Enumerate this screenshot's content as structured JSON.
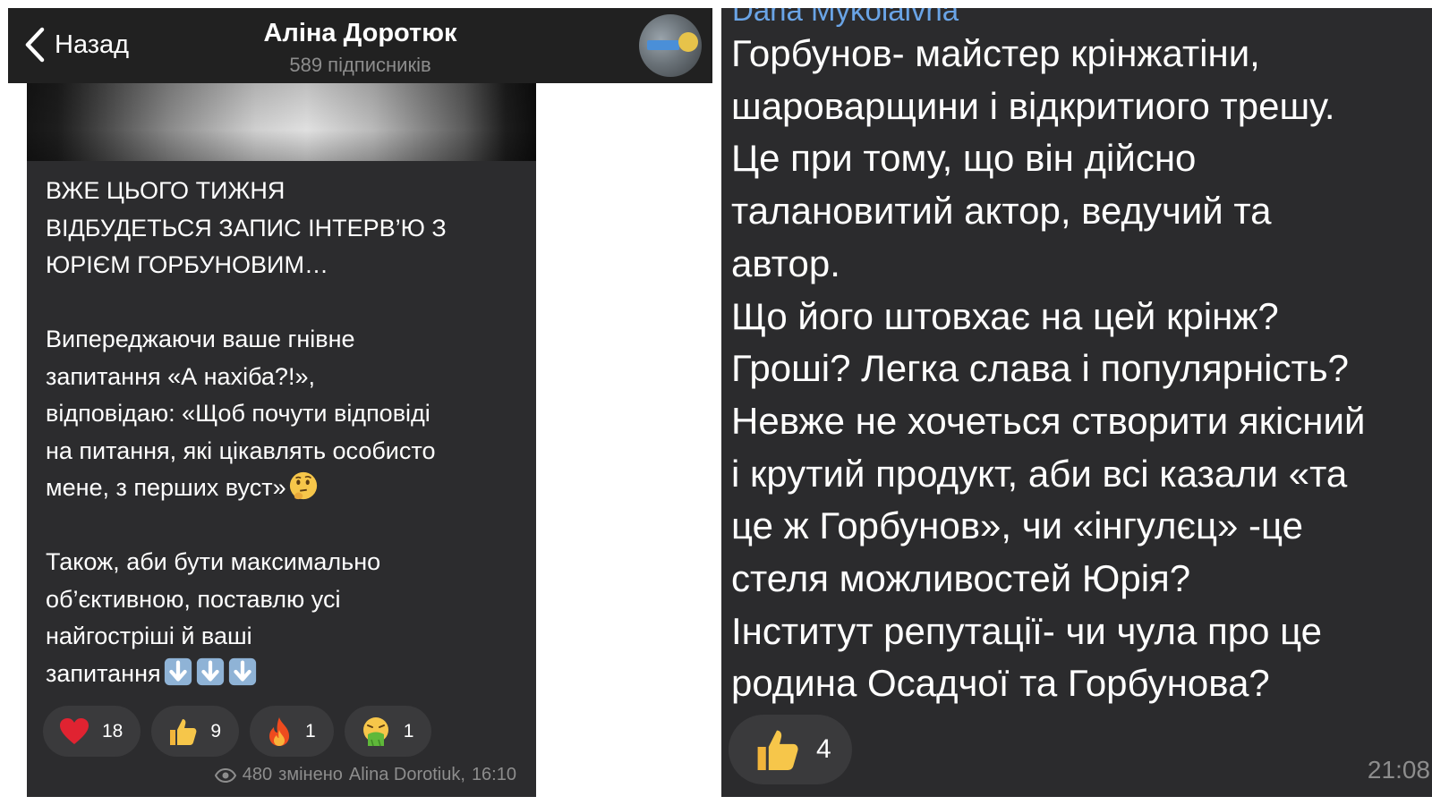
{
  "header": {
    "back_label": "Назад",
    "title": "Аліна Доротюк",
    "subtitle": "589 підписників"
  },
  "post": {
    "paragraphs": [
      [
        "ВЖЕ ЦЬОГО ТИЖНЯ",
        "ВІДБУДЕТЬСЯ ЗАПИС ІНТЕРВ’Ю З",
        "ЮРІЄМ ГОРБУНОВИМ…"
      ],
      [
        "Випереджаючи ваше гнівне",
        "запитання «А нахіба?!»,",
        "відповідаю: «Щоб почути відповіді",
        "на питання, які цікавлять особисто",
        "мене, з перших вуст»"
      ],
      [
        "Також, аби бути максимально",
        "об’єктивною, поставлю усі",
        "найгостріші й ваші",
        "запитання"
      ]
    ],
    "inline_emojis": {
      "thinking": "thinking-face-emoji",
      "arrows": [
        "down-arrow-emoji",
        "down-arrow-emoji",
        "down-arrow-emoji"
      ]
    },
    "reactions": [
      {
        "icon": "heart-emoji",
        "count": "18"
      },
      {
        "icon": "thumbs-up-emoji",
        "count": "9"
      },
      {
        "icon": "fire-emoji",
        "count": "1"
      },
      {
        "icon": "vomiting-face-emoji",
        "count": "1"
      }
    ],
    "views": "480",
    "edited_label": "змінено",
    "author": "Alina Dorotiuk",
    "time": "16:10"
  },
  "comment": {
    "sender": "Dana Mykolaivna",
    "lines": [
      "Горбунов- майстер крінжатіни,",
      "шароварщини і відкритиого трешу.",
      "Це при тому, що він дійсно",
      "талановитий актор, ведучий та",
      "автор.",
      "Що його штовхає на цей крінж?",
      "Гроші? Легка слава і популярність?",
      "Невже не хочеться створити якісний",
      "і крутий продукт, аби всі казали «та",
      "це ж Горбунов», чи «інгулєц» -це",
      "стеля можливостей Юрія?",
      "Інститут репутації- чи чула про це",
      "родина Осадчої та Горбунова?"
    ],
    "reaction": {
      "icon": "thumbs-up-emoji",
      "count": "4"
    },
    "time": "21:08"
  },
  "colors": {
    "header_bg": "#212121",
    "bubble_bg": "#2c2c2e",
    "reaction_bg": "#3a3a3c",
    "muted_text": "#8d8d8d",
    "sender_name": "#6aa4e6"
  }
}
